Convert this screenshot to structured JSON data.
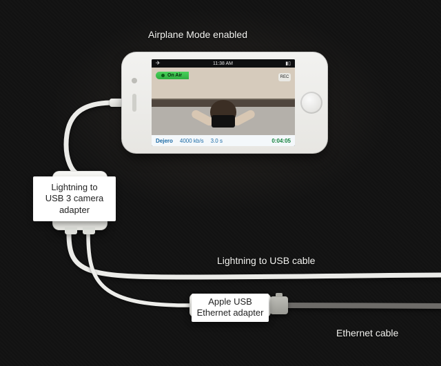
{
  "labels": {
    "airplane_mode": "Airplane Mode enabled",
    "usb3_adapter": "Lightning to\nUSB 3 camera\nadapter",
    "lightning_usb_cable": "Lightning to USB cable",
    "eth_adapter": "Apple USB\nEthernet adapter",
    "eth_cable": "Ethernet cable"
  },
  "phone": {
    "status_time": "11:38 AM",
    "live_pill": "On Air",
    "rec_badge": "REC",
    "bottombar": {
      "brand": "Dejero",
      "bitrate": "4000 kb/s",
      "latency": "3.0 s",
      "elapsed": "0:04:05"
    }
  }
}
